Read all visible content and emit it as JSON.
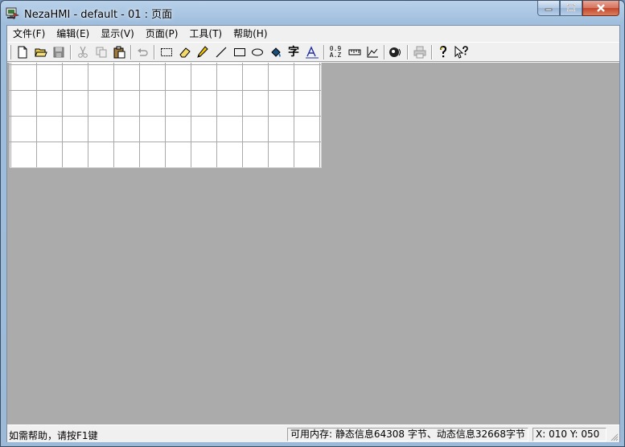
{
  "window": {
    "title": "NezaHMI - default - 01 : 页面"
  },
  "menu": [
    {
      "name": "menu-file",
      "label": "文件(F)"
    },
    {
      "name": "menu-edit",
      "label": "编辑(E)"
    },
    {
      "name": "menu-view",
      "label": "显示(V)"
    },
    {
      "name": "menu-page",
      "label": "页面(P)"
    },
    {
      "name": "menu-tools",
      "label": "工具(T)"
    },
    {
      "name": "menu-help",
      "label": "帮助(H)"
    }
  ],
  "toolbar": {
    "icons": [
      "new-file-icon",
      "open-folder-icon",
      "save-icon",
      "cut-icon",
      "copy-icon",
      "paste-icon",
      "undo-icon",
      "select-rect-icon",
      "eraser-icon",
      "pencil-icon",
      "line-icon",
      "rectangle-icon",
      "ellipse-icon",
      "fill-icon",
      "text-icon",
      "text-style-icon",
      "numeric-display-icon",
      "ruler-icon",
      "trend-chart-icon",
      "speaker-icon",
      "print-icon",
      "help-icon",
      "context-help-icon"
    ],
    "zi_glyph": "字",
    "num_top": "0.9",
    "num_bottom": "A.Z"
  },
  "statusbar": {
    "help_text": "如需帮助，请按F1键",
    "memory_text": "可用内存: 静态信息64308 字节、动态信息32668字节",
    "coords_text": "X: 010  Y: 050"
  },
  "colors": {
    "workspace": "#ababab",
    "canvas": "#ffffff",
    "grid": "#a9a9a9"
  }
}
